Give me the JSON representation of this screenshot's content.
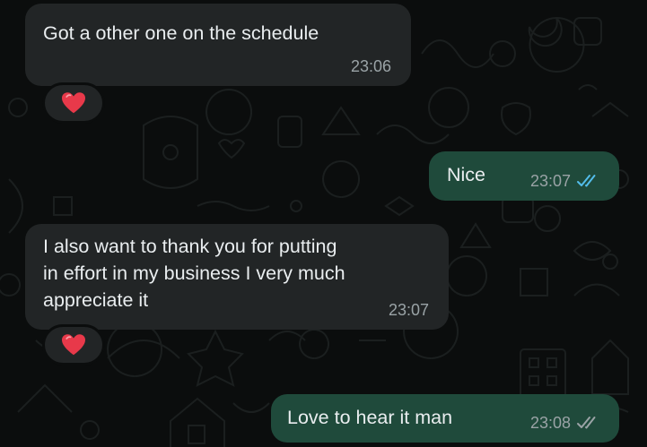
{
  "messages": [
    {
      "direction": "incoming",
      "text": "Got a other one on the schedule",
      "time": "23:06",
      "reaction": "heart-emoji"
    },
    {
      "direction": "outgoing",
      "text": "Nice",
      "time": "23:07",
      "status": "read",
      "status_color": "#53bdeb"
    },
    {
      "direction": "incoming",
      "text": "I also want to thank you for putting\nin effort in my business I very much\nappreciate it",
      "time": "23:07",
      "reaction": "heart-emoji"
    },
    {
      "direction": "outgoing",
      "text": "Love to hear it man",
      "time": "23:08",
      "status": "delivered",
      "status_color": "#9aa3a6"
    }
  ],
  "colors": {
    "background": "#0b0d0d",
    "incoming_bubble": "#222526",
    "outgoing_bubble": "#1f4a3b",
    "text": "#e9edef",
    "timestamp": "#9aa3a6",
    "heart": "#e8394a"
  }
}
